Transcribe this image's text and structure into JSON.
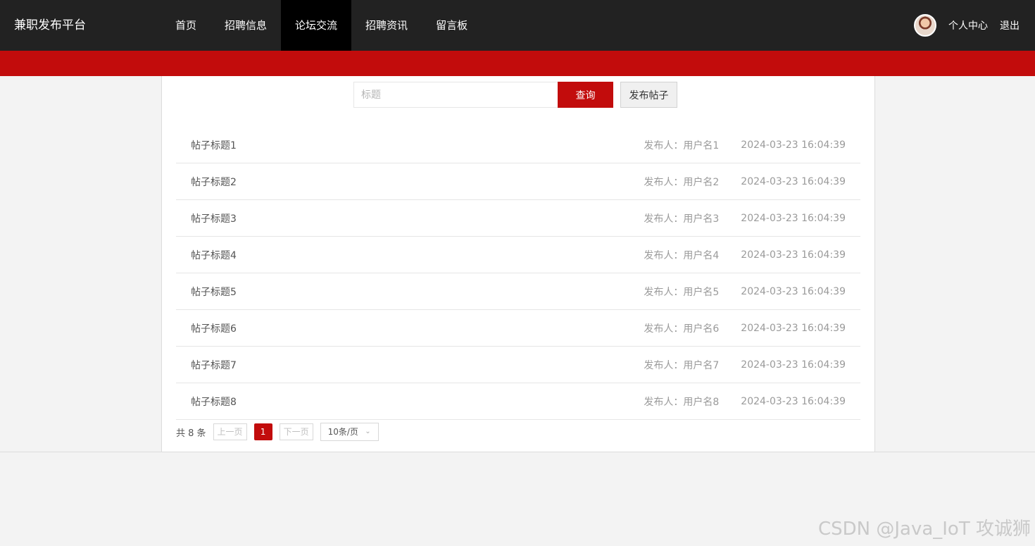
{
  "header": {
    "brand": "兼职发布平台",
    "nav": [
      {
        "label": "首页",
        "active": false
      },
      {
        "label": "招聘信息",
        "active": false
      },
      {
        "label": "论坛交流",
        "active": true
      },
      {
        "label": "招聘资讯",
        "active": false
      },
      {
        "label": "留言板",
        "active": false
      }
    ],
    "user_center": "个人中心",
    "logout": "退出"
  },
  "colors": {
    "topbar": "#222222",
    "accent": "#c20c0c",
    "nav_active": "#000000"
  },
  "search": {
    "placeholder": "标题",
    "value": "",
    "query_label": "查询",
    "post_label": "发布帖子"
  },
  "posts": [
    {
      "title": "帖子标题1",
      "author": "发布人：用户名1",
      "time": "2024-03-23 16:04:39"
    },
    {
      "title": "帖子标题2",
      "author": "发布人：用户名2",
      "time": "2024-03-23 16:04:39"
    },
    {
      "title": "帖子标题3",
      "author": "发布人：用户名3",
      "time": "2024-03-23 16:04:39"
    },
    {
      "title": "帖子标题4",
      "author": "发布人：用户名4",
      "time": "2024-03-23 16:04:39"
    },
    {
      "title": "帖子标题5",
      "author": "发布人：用户名5",
      "time": "2024-03-23 16:04:39"
    },
    {
      "title": "帖子标题6",
      "author": "发布人：用户名6",
      "time": "2024-03-23 16:04:39"
    },
    {
      "title": "帖子标题7",
      "author": "发布人：用户名7",
      "time": "2024-03-23 16:04:39"
    },
    {
      "title": "帖子标题8",
      "author": "发布人：用户名8",
      "time": "2024-03-23 16:04:39"
    }
  ],
  "pagination": {
    "total": "共 8 条",
    "prev": "上一页",
    "current": "1",
    "next": "下一页",
    "page_size": "10条/页"
  },
  "watermark": "CSDN @Java_IoT 攻诚狮"
}
